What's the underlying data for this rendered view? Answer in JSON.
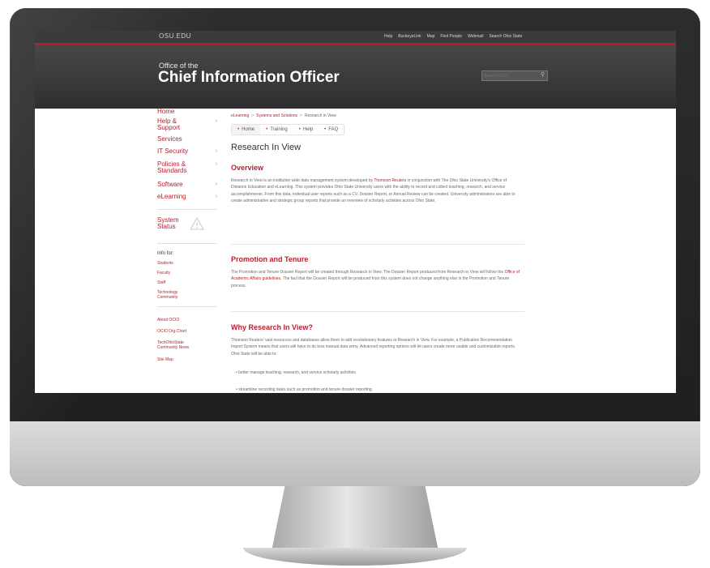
{
  "topbar": {
    "site": "OSU.EDU",
    "links": [
      "Help",
      "BuckeyeLink",
      "Map",
      "Find People",
      "Webmail",
      "Search Ohio State"
    ]
  },
  "header": {
    "pre_title": "Office of the",
    "title": "Chief Information Officer",
    "search_placeholder": "Search OCIO"
  },
  "sidebar": {
    "items": [
      {
        "label": "Home"
      },
      {
        "label": "Help &\nSupport"
      },
      {
        "label": "Services"
      },
      {
        "label": "IT Security"
      },
      {
        "label": "Policies &\nStandards"
      },
      {
        "label": "Software"
      },
      {
        "label": "eLearning"
      }
    ],
    "status_label": "System\nStatus",
    "info_heading": "Info for:",
    "info_links": [
      "Students",
      "Faculty",
      "Staff",
      "Technology\nCommunity"
    ],
    "bottom_links": [
      "About OCIO",
      "OCIO Org Chart",
      "TechOhioState\nCommunity News",
      "Site Map"
    ]
  },
  "main": {
    "breadcrumb": [
      "eLearning",
      "Systems and Solutions",
      "Research in View"
    ],
    "tabs": [
      "Home",
      "Training",
      "Help",
      "FAQ"
    ],
    "page_title": "Research In View",
    "sections": [
      {
        "heading": "Overview",
        "paragraph_a": "Research in View is an institution wide data management system developed by",
        "link": "Thomson Reuters",
        "paragraph_b": "in conjunction with The Ohio State University's Office of Distance Education and eLearning. This system provides Ohio State University users with the ability to record and collect teaching, research, and service accomplishments. From this data, individual user reports such as a CV, Dossier Report, or Annual Review can be created. University administrators are able to create administrative and strategic group reports that provide an overview of scholarly activities across Ohio State."
      },
      {
        "heading": "Promotion and Tenure",
        "paragraph_a": "The Promotion and Tenure Dossier Report will be created through Research in View. The Dossier Report produced from Research in View will follow the",
        "link": "Office of Academic Affairs guidelines.",
        "paragraph_b": "The fact that the Dossier Report will be produced from this system does not change anything else in the Promotion and Tenure process."
      },
      {
        "heading": "Why Research In View?",
        "paragraph_a": "Thomson Reuters' vast resources and databases allow them to add revolutionary features to Research in View. For example, a Publication Recommendation Import System means that users will have to do less manual data entry. Advanced reporting options will let users create more usable and customizable reports. Ohio State will be able to:",
        "bullets": [
          "better manage teaching, research, and service scholarly activities",
          "streamline recording tasks such as promotion and tenure dossier reporting"
        ]
      }
    ]
  }
}
